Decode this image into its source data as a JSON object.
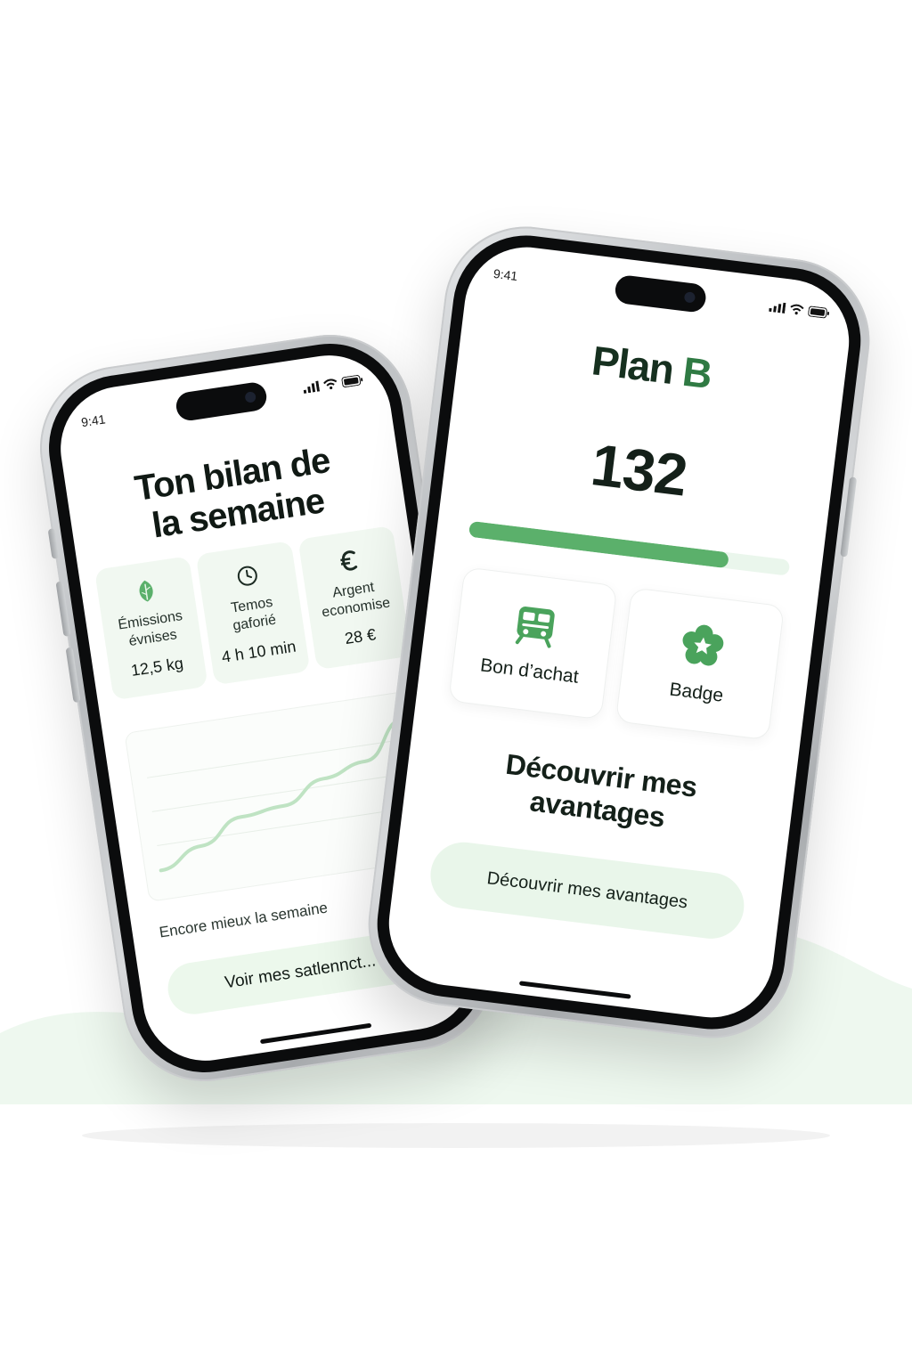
{
  "colors": {
    "accent_green": "#2f7a43",
    "light_green": "#5bb06b",
    "mint_bg": "#ecf8ec",
    "hill_green": "#eef8ef"
  },
  "phone_left": {
    "status_time": "9:41",
    "title_line1": "Ton bilan de",
    "title_line2": "la semaine",
    "stats": [
      {
        "icon": "leaf-icon",
        "label_line1": "Émissions",
        "label_line2": "évnises",
        "value": "12,5 kg"
      },
      {
        "icon": "clock-icon",
        "label_line1": "Temos",
        "label_line2": "gaforié",
        "value": "4 h 10 min"
      },
      {
        "icon": "euro-icon",
        "label_line1": "Argent",
        "label_line2": "economise",
        "value": "28 €"
      }
    ],
    "chart_data": {
      "type": "line",
      "title": "",
      "xlabel": "",
      "ylabel": "",
      "x": [
        1,
        2,
        3,
        4,
        5,
        6,
        7
      ],
      "values": [
        1,
        3,
        5.5,
        6,
        8.3,
        9.5,
        13.5
      ],
      "ylim": [
        0,
        15
      ],
      "grid": true
    },
    "encore_text": "Encore mieux la semaine",
    "cta_label": "Voir mes satlennct..."
  },
  "phone_right": {
    "status_time": "9:41",
    "title_main": "Plan",
    "title_accent": "B",
    "score": "132",
    "progress_percent": 81,
    "tiles": [
      {
        "icon": "train-icon",
        "label": "Bon d’achat"
      },
      {
        "icon": "badge-star-icon",
        "label": "Badge"
      }
    ],
    "heading_line1": "Découvrir mes",
    "heading_line2": "avantages",
    "cta_label": "Découvrir mes avantages"
  }
}
